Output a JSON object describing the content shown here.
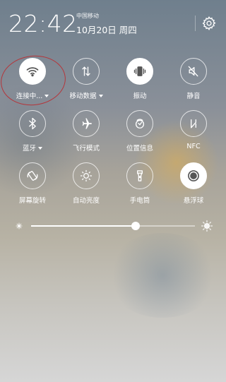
{
  "status": {
    "time": "22:42",
    "carrier": "中国移动",
    "date": "10月20日 周四"
  },
  "tiles": [
    {
      "label": "连接中...",
      "icon": "wifi-icon",
      "on": true,
      "caret": true
    },
    {
      "label": "移动数据",
      "icon": "mobile-data-icon",
      "on": false,
      "caret": true
    },
    {
      "label": "振动",
      "icon": "vibrate-icon",
      "on": true,
      "caret": false
    },
    {
      "label": "静音",
      "icon": "mute-icon",
      "on": false,
      "caret": false
    },
    {
      "label": "蓝牙",
      "icon": "bluetooth-icon",
      "on": false,
      "caret": true
    },
    {
      "label": "飞行模式",
      "icon": "airplane-icon",
      "on": false,
      "caret": false
    },
    {
      "label": "位置信息",
      "icon": "location-icon",
      "on": false,
      "caret": false
    },
    {
      "label": "NFC",
      "icon": "nfc-icon",
      "on": false,
      "caret": false
    },
    {
      "label": "屏幕旋转",
      "icon": "rotate-icon",
      "on": false,
      "caret": false
    },
    {
      "label": "自动亮度",
      "icon": "auto-brightness-icon",
      "on": false,
      "caret": false
    },
    {
      "label": "手电筒",
      "icon": "flashlight-icon",
      "on": false,
      "caret": false
    },
    {
      "label": "悬浮球",
      "icon": "floating-ball-icon",
      "on": true,
      "caret": false
    }
  ],
  "brightness": {
    "level": 0.64
  },
  "colors": {
    "highlight_ring": "#b5353a"
  }
}
